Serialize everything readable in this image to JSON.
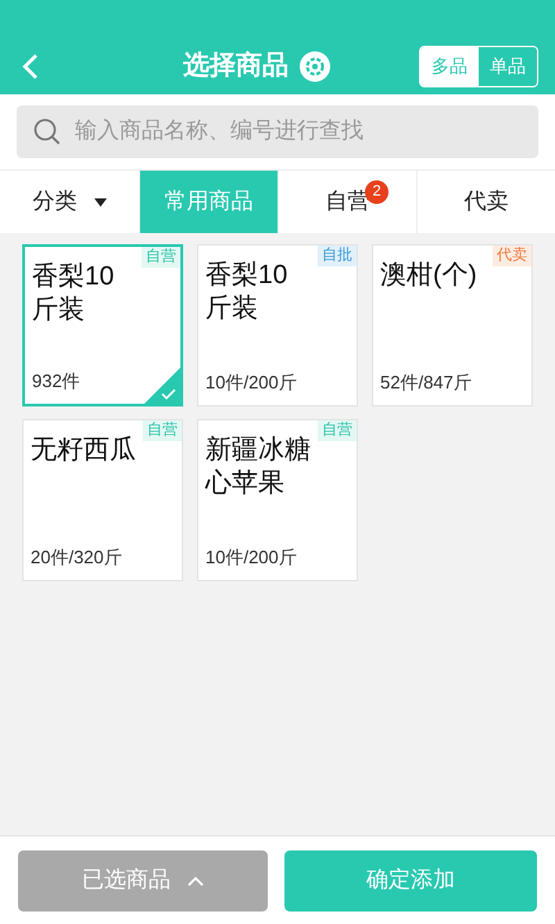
{
  "header": {
    "title": "选择商品",
    "modes": [
      {
        "label": "多品",
        "selected": true
      },
      {
        "label": "单品",
        "selected": false
      }
    ]
  },
  "search": {
    "placeholder": "输入商品名称、编号进行查找"
  },
  "category": {
    "label": "分类"
  },
  "tabs": [
    {
      "label": "常用商品",
      "selected": true
    },
    {
      "label": "自营",
      "selected": false,
      "badge": "2"
    },
    {
      "label": "代卖",
      "selected": false
    }
  ],
  "products": [
    {
      "name": "香梨10斤装",
      "stock": "932件",
      "tag": "自营",
      "kind": "self",
      "selected": true
    },
    {
      "name": "香梨10斤装",
      "stock": "10件/200斤",
      "tag": "自批",
      "kind": "batch",
      "selected": false
    },
    {
      "name": "澳柑(个)",
      "stock": "52件/847斤",
      "tag": "代卖",
      "kind": "consign",
      "selected": false
    },
    {
      "name": "无籽西瓜",
      "stock": "20件/320斤",
      "tag": "自营",
      "kind": "self",
      "selected": false
    },
    {
      "name": "新疆冰糖心苹果",
      "stock": "10件/200斤",
      "tag": "自营",
      "kind": "self",
      "selected": false
    }
  ],
  "footer": {
    "selected_button": "已选商品",
    "confirm_button": "确定添加"
  }
}
